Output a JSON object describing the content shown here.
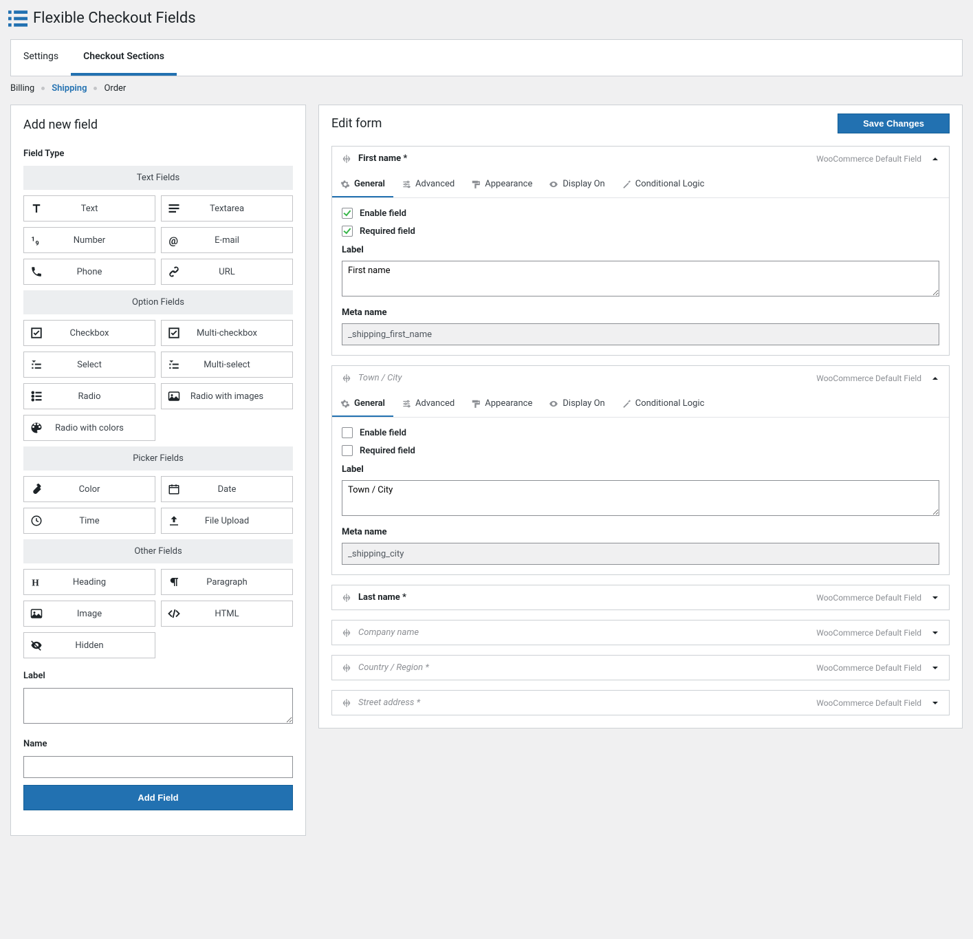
{
  "header": {
    "title": "Flexible Checkout Fields"
  },
  "tabs": {
    "settings": "Settings",
    "sections": "Checkout Sections"
  },
  "subnav": {
    "billing": "Billing",
    "shipping": "Shipping",
    "order": "Order"
  },
  "left": {
    "title": "Add new field",
    "field_type_label": "Field Type",
    "cats": {
      "text": "Text Fields",
      "option": "Option Fields",
      "picker": "Picker Fields",
      "other": "Other Fields"
    },
    "types": {
      "text": "Text",
      "textarea": "Textarea",
      "number": "Number",
      "email": "E-mail",
      "phone": "Phone",
      "url": "URL",
      "checkbox": "Checkbox",
      "multi_checkbox": "Multi-checkbox",
      "select": "Select",
      "multi_select": "Multi-select",
      "radio": "Radio",
      "radio_images": "Radio with images",
      "radio_colors": "Radio with colors",
      "color": "Color",
      "date": "Date",
      "time": "Time",
      "file": "File Upload",
      "heading": "Heading",
      "paragraph": "Paragraph",
      "image": "Image",
      "html": "HTML",
      "hidden": "Hidden"
    },
    "label_label": "Label",
    "name_label": "Name",
    "add_button": "Add Field"
  },
  "right": {
    "title": "Edit form",
    "save": "Save Changes",
    "field_tabs": {
      "general": "General",
      "advanced": "Advanced",
      "appearance": "Appearance",
      "display_on": "Display On",
      "conditional": "Conditional Logic"
    },
    "general": {
      "enable": "Enable field",
      "required": "Required field",
      "label_label": "Label",
      "meta_label": "Meta name"
    },
    "badge": "WooCommerce Default Field",
    "cards": [
      {
        "title": "First name *",
        "dim": false,
        "open": true,
        "enable": true,
        "required": true,
        "label": "First name",
        "meta": "_shipping_first_name"
      },
      {
        "title": "Town / City",
        "dim": true,
        "open": true,
        "enable": false,
        "required": false,
        "label": "Town / City",
        "meta": "_shipping_city"
      },
      {
        "title": "Last name *",
        "dim": false,
        "open": false
      },
      {
        "title": "Company name",
        "dim": true,
        "open": false
      },
      {
        "title": "Country / Region *",
        "dim": true,
        "open": false
      },
      {
        "title": "Street address *",
        "dim": true,
        "open": false
      }
    ]
  }
}
